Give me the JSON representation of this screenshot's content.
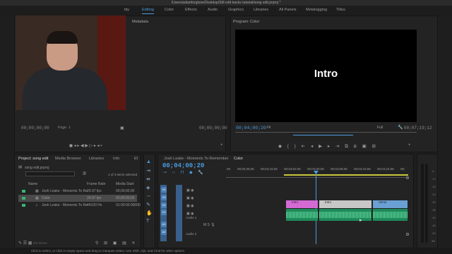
{
  "window": {
    "title": "/Users/adamforglone/Desktop/SM edit tracks tutorial/song edit.prproj *"
  },
  "workspaces": [
    {
      "label": "bly"
    },
    {
      "label": "Editing",
      "active": true
    },
    {
      "label": "Color"
    },
    {
      "label": "Effects"
    },
    {
      "label": "Audio"
    },
    {
      "label": "Graphics"
    },
    {
      "label": "Libraries"
    },
    {
      "label": "All Panels"
    },
    {
      "label": "Metalogging"
    },
    {
      "label": "Titles"
    }
  ],
  "source": {
    "metadata_tab": "Metadata",
    "tc_left": "00;00;00;00",
    "tc_right": "00;00;00;00",
    "page": "Page 1"
  },
  "program": {
    "title": "Program: Color",
    "overlay_text": "Intro",
    "timecode": "00;04;00;20",
    "fit": "Fit",
    "quality": "Full",
    "duration": "00;07;19;12"
  },
  "project": {
    "tabs": [
      "Project: song edit",
      "Media Browser",
      "Libraries",
      "Info",
      "Ef"
    ],
    "filename": "song edit.prproj",
    "selection_info": "1 of 3 items selected",
    "columns": [
      "Name",
      "Frame Rate",
      "Media Start"
    ],
    "rows": [
      {
        "name": "Josh Leake - Moments To Re",
        "frame_rate": "29.97 fps",
        "media_start": "00;00;00;00",
        "color": "#3cb371"
      },
      {
        "name": "Color",
        "frame_rate": "29.97 fps",
        "media_start": "00;00;00;00",
        "color": "#3cb371",
        "selected": true
      },
      {
        "name": "Josh Leake - Moments To Re",
        "frame_rate": "44100 Hz",
        "media_start": "01:00:00:00000",
        "color": "#3cb371"
      }
    ]
  },
  "timeline": {
    "tabs": [
      "Josh Leake - Moments To Remember",
      "Color"
    ],
    "timecode": "00;04;00;20",
    "ruler": [
      "0K",
      "00;03;36;06",
      "00;03;44;06",
      "00;03;52;06",
      "00;04;00;08",
      "00;04;08;08",
      "00;04;16;08",
      "00;04;24;08",
      "00;"
    ],
    "video_tracks": [
      "V4",
      "V3",
      "V2",
      "V1"
    ],
    "audio_tracks": [
      "A1",
      "A2"
    ],
    "audio_labels": [
      "Audio 1",
      "Audio 2"
    ],
    "clips": [
      {
        "label": "Intro",
        "color": "#d46ad4"
      },
      {
        "label": "Intro",
        "color": "#c7c7c7"
      },
      {
        "label": "Verse",
        "color": "#6aa0d4"
      }
    ]
  },
  "meter": {
    "labels": [
      "-6",
      "-12",
      "-18",
      "-24",
      "-30",
      "-36",
      "-42",
      "-48",
      "-54",
      "dB"
    ]
  },
  "status": {
    "text": "Click to select, or click in empty space and drag to marquee select. Use Shift, Opt, and Cmd for other options."
  }
}
